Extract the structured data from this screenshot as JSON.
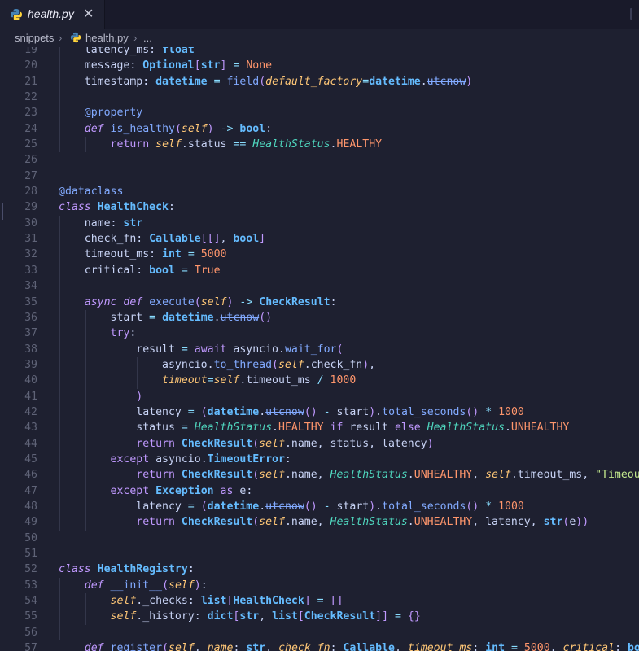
{
  "tab": {
    "title": "health.py",
    "close": "✕"
  },
  "breadcrumb": {
    "folder": "snippets",
    "sep1": "›",
    "file": "health.py",
    "sep2": "›",
    "more": "..."
  },
  "editor": {
    "lines": [
      {
        "n": "19",
        "html": "    <span class=\"code-plain\">latency_ms</span>: <span class=\"ty\">float</span>"
      },
      {
        "n": "20",
        "html": "    message: <span class=\"ty\">Optional</span><span class=\"br\">[</span><span class=\"ty\">str</span><span class=\"br\">]</span> <span class=\"op\">=</span> <span class=\"const\">None</span>"
      },
      {
        "n": "21",
        "html": "    timestamp: <span class=\"ty\">datetime</span> <span class=\"op\">=</span> <span class=\"fn\">field</span><span class=\"br\">(</span><span class=\"param\">default_factory</span><span class=\"op\">=</span><span class=\"ty\">datetime</span>.<span class=\"strike\">utcnow</span><span class=\"br\">)</span>"
      },
      {
        "n": "22",
        "html": ""
      },
      {
        "n": "23",
        "html": "    <span class=\"fn\">@property</span>"
      },
      {
        "n": "24",
        "html": "    <span class=\"kw\">def</span> <span class=\"fn\">is_healthy</span><span class=\"br\">(</span><span class=\"self\">self</span><span class=\"br\">)</span> <span class=\"op\">-&gt;</span> <span class=\"ty\">bool</span>:"
      },
      {
        "n": "25",
        "html": "        <span class=\"kwn\">return</span> <span class=\"self\">self</span>.status <span class=\"op\">==</span> <span class=\"tyi\">HealthStatus</span>.<span class=\"const\">HEALTHY</span>"
      },
      {
        "n": "26",
        "html": ""
      },
      {
        "n": "27",
        "html": ""
      },
      {
        "n": "28",
        "html": "<span class=\"fn\">@dataclass</span>"
      },
      {
        "n": "29",
        "html": "<span class=\"kw\">class</span> <span class=\"ty\">HealthCheck</span>:"
      },
      {
        "n": "30",
        "html": "    name: <span class=\"ty\">str</span>"
      },
      {
        "n": "31",
        "html": "    check_fn: <span class=\"ty\">Callable</span><span class=\"br\">[[]</span>, <span class=\"ty\">bool</span><span class=\"br\">]</span>"
      },
      {
        "n": "32",
        "html": "    timeout_ms: <span class=\"ty\">int</span> <span class=\"op\">=</span> <span class=\"num\">5000</span>"
      },
      {
        "n": "33",
        "html": "    critical: <span class=\"ty\">bool</span> <span class=\"op\">=</span> <span class=\"const\">True</span>"
      },
      {
        "n": "34",
        "html": ""
      },
      {
        "n": "35",
        "html": "    <span class=\"kw\">async</span> <span class=\"kw\">def</span> <span class=\"fn\">execute</span><span class=\"br\">(</span><span class=\"self\">self</span><span class=\"br\">)</span> <span class=\"op\">-&gt;</span> <span class=\"ty\">CheckResult</span>:"
      },
      {
        "n": "36",
        "html": "        start <span class=\"op\">=</span> <span class=\"ty\">datetime</span>.<span class=\"strike\">utcnow</span><span class=\"br\">()</span>"
      },
      {
        "n": "37",
        "html": "        <span class=\"kwn\">try</span>:"
      },
      {
        "n": "38",
        "html": "            result <span class=\"op\">=</span> <span class=\"kwn\">await</span> asyncio.<span class=\"fn\">wait_for</span><span class=\"br\">(</span>"
      },
      {
        "n": "39",
        "html": "                asyncio.<span class=\"fn\">to_thread</span><span class=\"br\">(</span><span class=\"self\">self</span>.check_fn<span class=\"br\">)</span>,"
      },
      {
        "n": "40",
        "html": "                <span class=\"param\">timeout</span><span class=\"op\">=</span><span class=\"self\">self</span>.timeout_ms <span class=\"op\">/</span> <span class=\"num\">1000</span>"
      },
      {
        "n": "41",
        "html": "            <span class=\"br\">)</span>"
      },
      {
        "n": "42",
        "html": "            latency <span class=\"op\">=</span> <span class=\"br\">(</span><span class=\"ty\">datetime</span>.<span class=\"strike\">utcnow</span><span class=\"br\">()</span> <span class=\"op\">-</span> start<span class=\"br\">)</span>.<span class=\"fn\">total_seconds</span><span class=\"br\">()</span> <span class=\"op\">*</span> <span class=\"num\">1000</span>"
      },
      {
        "n": "43",
        "html": "            status <span class=\"op\">=</span> <span class=\"tyi\">HealthStatus</span>.<span class=\"const\">HEALTHY</span> <span class=\"kwn\">if</span> result <span class=\"kwn\">else</span> <span class=\"tyi\">HealthStatus</span>.<span class=\"const\">UNHEALTHY</span>"
      },
      {
        "n": "44",
        "html": "            <span class=\"kwn\">return</span> <span class=\"ty\">CheckResult</span><span class=\"br\">(</span><span class=\"self\">self</span>.name, status, latency<span class=\"br\">)</span>"
      },
      {
        "n": "45",
        "html": "        <span class=\"kwn\">except</span> asyncio.<span class=\"ty\">TimeoutError</span>:"
      },
      {
        "n": "46",
        "html": "            <span class=\"kwn\">return</span> <span class=\"ty\">CheckResult</span><span class=\"br\">(</span><span class=\"self\">self</span>.name, <span class=\"tyi\">HealthStatus</span>.<span class=\"const\">UNHEALTHY</span>, <span class=\"self\">self</span>.timeout_ms, <span class=\"str\">\"Timeout\"</span><span class=\"br\">)</span>"
      },
      {
        "n": "47",
        "html": "        <span class=\"kwn\">except</span> <span class=\"ty\">Exception</span> <span class=\"kwn\">as</span> e:"
      },
      {
        "n": "48",
        "html": "            latency <span class=\"op\">=</span> <span class=\"br\">(</span><span class=\"ty\">datetime</span>.<span class=\"strike\">utcnow</span><span class=\"br\">()</span> <span class=\"op\">-</span> start<span class=\"br\">)</span>.<span class=\"fn\">total_seconds</span><span class=\"br\">()</span> <span class=\"op\">*</span> <span class=\"num\">1000</span>"
      },
      {
        "n": "49",
        "html": "            <span class=\"kwn\">return</span> <span class=\"ty\">CheckResult</span><span class=\"br\">(</span><span class=\"self\">self</span>.name, <span class=\"tyi\">HealthStatus</span>.<span class=\"const\">UNHEALTHY</span>, latency, <span class=\"ty\">str</span><span class=\"br\">(</span>e<span class=\"br\">))</span>"
      },
      {
        "n": "50",
        "html": ""
      },
      {
        "n": "51",
        "html": ""
      },
      {
        "n": "52",
        "html": "<span class=\"kw\">class</span> <span class=\"ty\">HealthRegistry</span>:"
      },
      {
        "n": "53",
        "html": "    <span class=\"kw\">def</span> <span class=\"fn\">__init__</span><span class=\"br\">(</span><span class=\"self\">self</span><span class=\"br\">)</span>:"
      },
      {
        "n": "54",
        "html": "        <span class=\"self\">self</span>._checks: <span class=\"ty\">list</span><span class=\"br\">[</span><span class=\"ty\">HealthCheck</span><span class=\"br\">]</span> <span class=\"op\">=</span> <span class=\"br\">[]</span>"
      },
      {
        "n": "55",
        "html": "        <span class=\"self\">self</span>._history: <span class=\"ty\">dict</span><span class=\"br\">[</span><span class=\"ty\">str</span>, <span class=\"ty\">list</span><span class=\"br\">[</span><span class=\"ty\">CheckResult</span><span class=\"br\">]]</span> <span class=\"op\">=</span> <span class=\"br\">{}</span>"
      },
      {
        "n": "56",
        "html": ""
      },
      {
        "n": "57",
        "html": "    <span class=\"kw\">def</span> <span class=\"fn\">register</span><span class=\"br\">(</span><span class=\"self\">self</span>, <span class=\"param\">name</span>: <span class=\"ty\">str</span>, <span class=\"param\">check_fn</span>: <span class=\"ty\">Callable</span>, <span class=\"param\">timeout_ms</span>: <span class=\"ty\">int</span> <span class=\"op\">=</span> <span class=\"num\">5000</span>, <span class=\"param\">critical</span>: <span class=\"ty\">bool</span>"
      }
    ]
  }
}
